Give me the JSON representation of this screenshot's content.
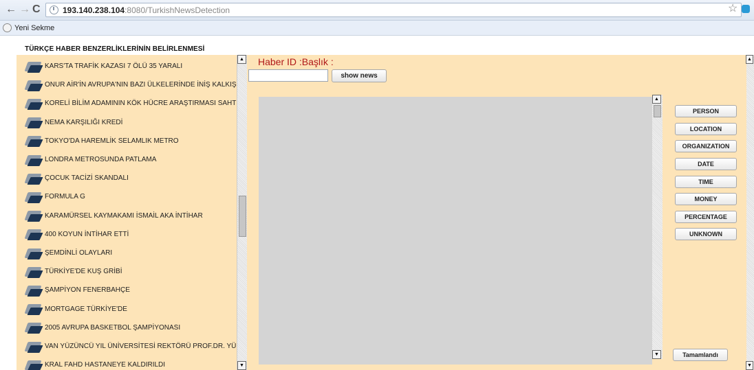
{
  "browser": {
    "url_host": "193.140.238.104",
    "url_rest": ":8080/TurkishNewsDetection",
    "bookmark_label": "Yeni Sekme"
  },
  "page": {
    "title": "TÜRKÇE HABER BENZERLİKLERİNİN BELİRLENMESİ"
  },
  "news_list": [
    {
      "label": "KARS'TA TRAFİK KAZASI 7 ÖLÜ 35 YARALI"
    },
    {
      "label": "ONUR AİR'İN AVRUPA'NIN BAZI ÜLKELERİNDE İNİŞ KALKIŞ"
    },
    {
      "label": "KORELİ BİLİM ADAMININ KÖK HÜCRE ARAŞTIRMASI SAHTE"
    },
    {
      "label": "NEMA KARŞILIĞI KREDİ"
    },
    {
      "label": "TOKYO'DA HAREMLİK SELAMLIK METRO"
    },
    {
      "label": "LONDRA METROSUNDA PATLAMA"
    },
    {
      "label": "ÇOCUK TACİZİ SKANDALI"
    },
    {
      "label": "FORMULA G"
    },
    {
      "label": "KARAMÜRSEL KAYMAKAMI İSMAİL AKA İNTİHAR"
    },
    {
      "label": "400 KOYUN İNTİHAR ETTİ"
    },
    {
      "label": "ŞEMDİNLİ OLAYLARI"
    },
    {
      "label": "TÜRKİYE'DE KUŞ GRİBİ"
    },
    {
      "label": "ŞAMPİYON FENERBAHÇE"
    },
    {
      "label": "MORTGAGE TÜRKİYE'DE"
    },
    {
      "label": "2005 AVRUPA BASKETBOL ŞAMPİYONASI"
    },
    {
      "label": "VAN YÜZÜNCÜ YIL ÜNİVERSİTESİ REKTÖRÜ PROF.DR. YÜ"
    },
    {
      "label": "KRAL FAHD HASTANEYE KALDIRILDI"
    }
  ],
  "detail": {
    "heading": "Haber ID :Başlık :",
    "id_value": "",
    "show_button": "show news",
    "tags": [
      "PERSON",
      "LOCATION",
      "ORGANIZATION",
      "DATE",
      "TIME",
      "MONEY",
      "PERCENTAGE",
      "UNKNOWN"
    ],
    "done_button": "Tamamlandı"
  }
}
